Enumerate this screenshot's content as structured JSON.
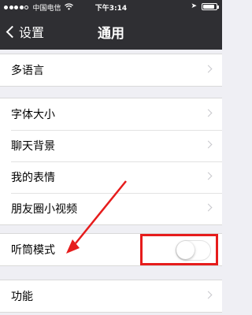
{
  "status_bar": {
    "carrier": "中国电信",
    "time": "下午3:14",
    "signal_bars_filled": 4,
    "signal_bars_total": 5,
    "battery_level": 0.9
  },
  "nav": {
    "back_label": "设置",
    "title": "通用"
  },
  "sections": [
    {
      "items": [
        {
          "label": "多语言"
        }
      ]
    },
    {
      "items": [
        {
          "label": "字体大小"
        },
        {
          "label": "聊天背景"
        },
        {
          "label": "我的表情"
        },
        {
          "label": "朋友圈小视频"
        }
      ]
    },
    {
      "items": [
        {
          "label": "听筒模式",
          "toggle_on": false
        }
      ]
    },
    {
      "items": [
        {
          "label": "功能"
        }
      ]
    }
  ],
  "annotation": {
    "color": "#e61c1c"
  }
}
